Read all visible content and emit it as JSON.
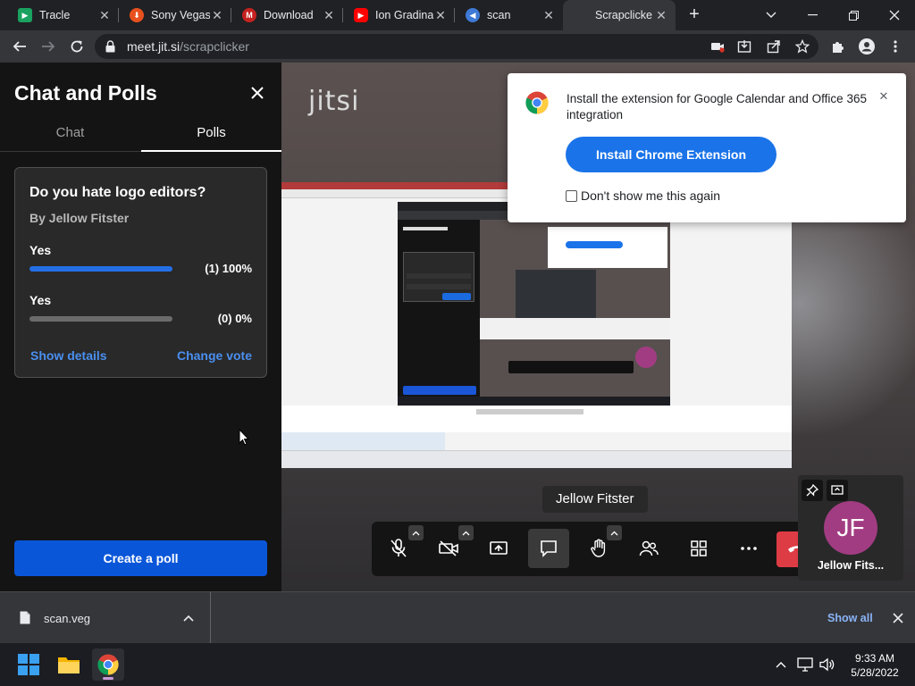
{
  "browser": {
    "tabs": [
      {
        "title": "Tracle",
        "favicon_color": "#1aa260",
        "favicon_glyph": "▶",
        "active": false
      },
      {
        "title": "Sony Vegas",
        "favicon_color": "#e8501e",
        "favicon_glyph": "⬇",
        "active": false
      },
      {
        "title": "Download",
        "favicon_color": "#c5221f",
        "favicon_glyph": "M",
        "active": false
      },
      {
        "title": "Ion Gradina",
        "favicon_color": "#ff0000",
        "favicon_glyph": "▶",
        "active": false
      },
      {
        "title": "scan",
        "favicon_color": "#3e7ad6",
        "favicon_glyph": "◀",
        "active": false
      },
      {
        "title": "Scrapclicke",
        "favicon_color": "",
        "favicon_glyph": "",
        "active": true
      }
    ],
    "url_host": "meet.jit.si",
    "url_path": "/scrapclicker"
  },
  "panel": {
    "title": "Chat and Polls",
    "tabs": [
      "Chat",
      "Polls"
    ],
    "selected_tab": "Polls",
    "poll": {
      "question": "Do you hate logo editors?",
      "author": "By Jellow Fitster",
      "options": [
        {
          "label": "Yes",
          "result": "(1) 100%",
          "fraction": 1.0
        },
        {
          "label": "Yes",
          "result": "(0) 0%",
          "fraction": 0.0
        }
      ],
      "show_details": "Show details",
      "change_vote": "Change vote"
    },
    "create_poll": "Create a poll"
  },
  "stage": {
    "logo": "jitsi",
    "speaker_label": "Jellow Fitster",
    "thumbnail": {
      "initials": "JF",
      "name": "Jellow Fits...",
      "avatar_color": "#a23c82"
    }
  },
  "popup": {
    "message": "Install the extension for Google Calendar and Office 365 integration",
    "button": "Install Chrome Extension",
    "checkbox_label": "Don't show me this again"
  },
  "downloads": {
    "file": "scan.veg",
    "show_all": "Show all"
  },
  "taskbar": {
    "time": "9:33 AM",
    "date": "5/28/2022"
  },
  "colors": {
    "accent_blue": "#0a56d9",
    "hangup_red": "#dd3c45",
    "poll_bar": "#246fe5"
  }
}
